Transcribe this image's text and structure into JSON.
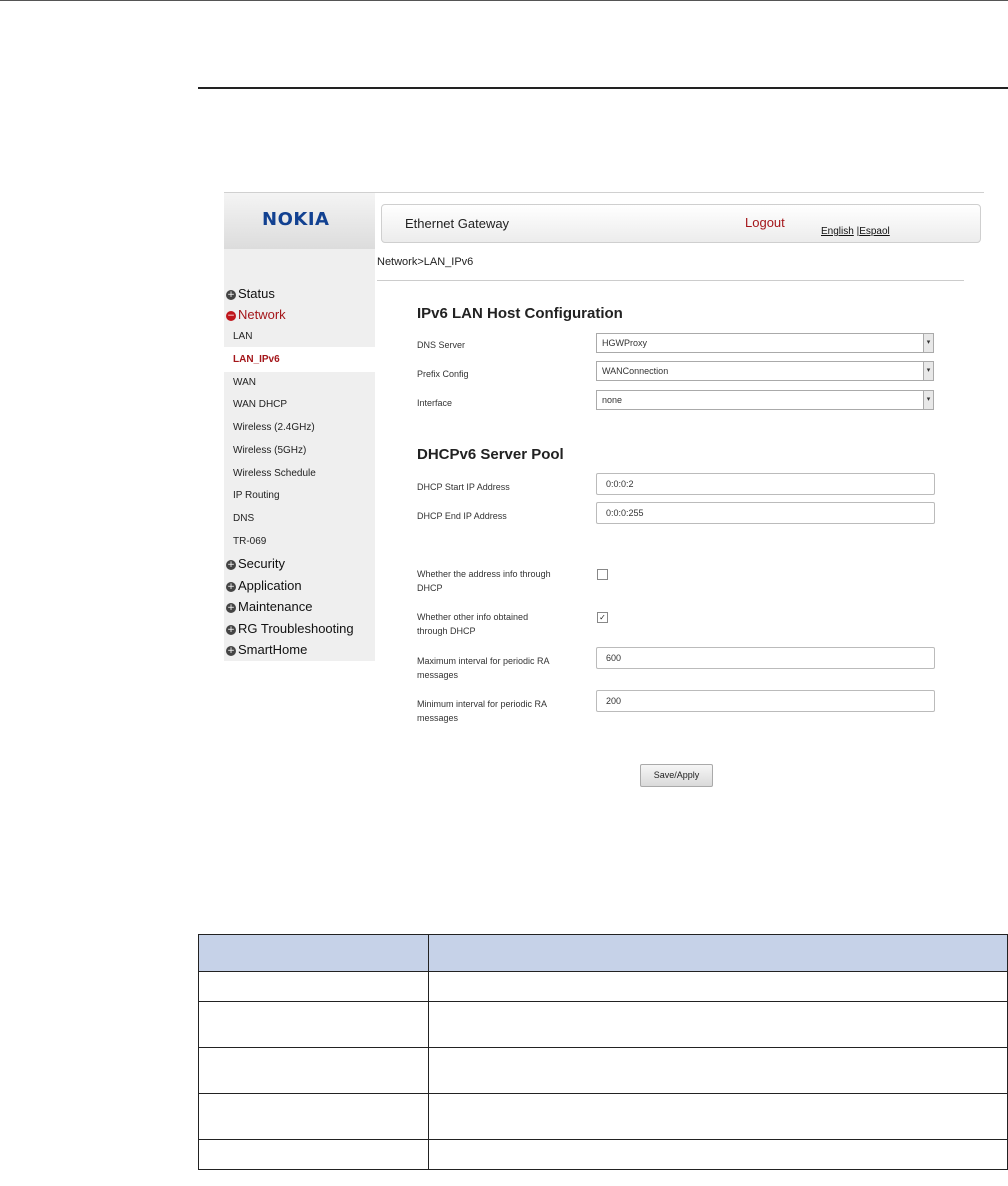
{
  "header": {
    "logo": "NOKIA",
    "title": "Ethernet Gateway",
    "logout": "Logout",
    "lang_english": "English",
    "lang_sep": " |",
    "lang_spanish": "Espaol"
  },
  "breadcrumb": "Network>LAN_IPv6",
  "sidebar": {
    "top_items": [
      {
        "label": "Status",
        "icon": "plus-icon"
      },
      {
        "label": "Network",
        "icon": "minus-icon"
      },
      {
        "label": "Security",
        "icon": "plus-icon"
      },
      {
        "label": "Application",
        "icon": "plus-icon"
      },
      {
        "label": "Maintenance",
        "icon": "plus-icon"
      },
      {
        "label": "RG Troubleshooting",
        "icon": "plus-icon"
      },
      {
        "label": "SmartHome",
        "icon": "plus-icon"
      }
    ],
    "sub_items": [
      "LAN",
      "LAN_IPv6",
      "WAN",
      "WAN DHCP",
      "Wireless (2.4GHz)",
      "Wireless (5GHz)",
      "Wireless Schedule",
      "IP Routing",
      "DNS",
      "TR-069"
    ],
    "active_sub": "LAN_IPv6"
  },
  "ipv6_section": {
    "title": "IPv6 LAN Host Configuration",
    "dns_server_label": "DNS Server",
    "dns_server_value": "HGWProxy",
    "prefix_config_label": "Prefix Config",
    "prefix_config_value": "WANConnection",
    "interface_label": "Interface",
    "interface_value": "none"
  },
  "dhcp_section": {
    "title": "DHCPv6 Server Pool",
    "start_label": "DHCP Start IP Address",
    "start_value": "0:0:0:2",
    "end_label": "DHCP End IP Address",
    "end_value": "0:0:0:255",
    "addr_info_label_1": "Whether the address info through",
    "addr_info_label_2": "DHCP",
    "addr_info_checked": false,
    "other_info_label_1": "Whether other info obtained",
    "other_info_label_2": "through DHCP",
    "other_info_checked": true,
    "max_ra_label_1": "Maximum interval for periodic RA",
    "max_ra_label_2": "messages",
    "max_ra_value": "600",
    "min_ra_label_1": "Minimum interval for periodic RA",
    "min_ra_label_2": "messages",
    "min_ra_value": "200"
  },
  "save_button": "Save/Apply",
  "checkmark": "✓",
  "arrow_glyph": "▾",
  "colors": {
    "brand_blue": "#124191",
    "accent_red": "#a4161a",
    "table_header": "#c6d2e8"
  }
}
